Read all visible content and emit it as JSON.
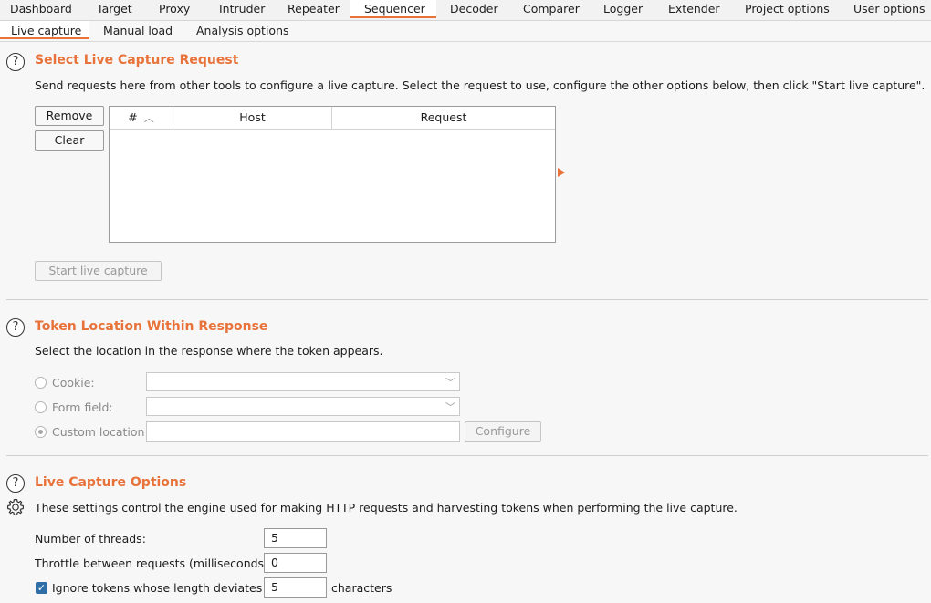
{
  "tabs": [
    "Dashboard",
    "Target",
    "Proxy",
    "Intruder",
    "Repeater",
    "Sequencer",
    "Decoder",
    "Comparer",
    "Logger",
    "Extender",
    "Project options",
    "User options"
  ],
  "subtabs": [
    "Live capture",
    "Manual load",
    "Analysis options"
  ],
  "section1": {
    "title": "Select Live Capture Request",
    "description": "Send requests here from other tools to configure a live capture. Select the request to use, configure the other options below, then click \"Start live capture\".",
    "remove_label": "Remove",
    "clear_label": "Clear",
    "columns": [
      "#",
      "Host",
      "Request"
    ],
    "start_label": "Start live capture"
  },
  "section2": {
    "title": "Token Location Within Response",
    "description": "Select the location in the response where the token appears.",
    "cookie_label": "Cookie:",
    "form_field_label": "Form field:",
    "custom_location_label": "Custom location:",
    "configure_label": "Configure"
  },
  "section3": {
    "title": "Live Capture Options",
    "description": "These settings control the engine used for making HTTP requests and harvesting tokens when performing the live capture.",
    "threads_label": "Number of threads:",
    "threads_value": "5",
    "throttle_label": "Throttle between requests (milliseconds):",
    "throttle_value": "0",
    "ignore_label": "Ignore tokens whose length deviates by",
    "ignore_value": "5",
    "ignore_suffix": "characters"
  },
  "colors": {
    "accent": "#e8733a",
    "checkbox": "#2f6da6"
  }
}
